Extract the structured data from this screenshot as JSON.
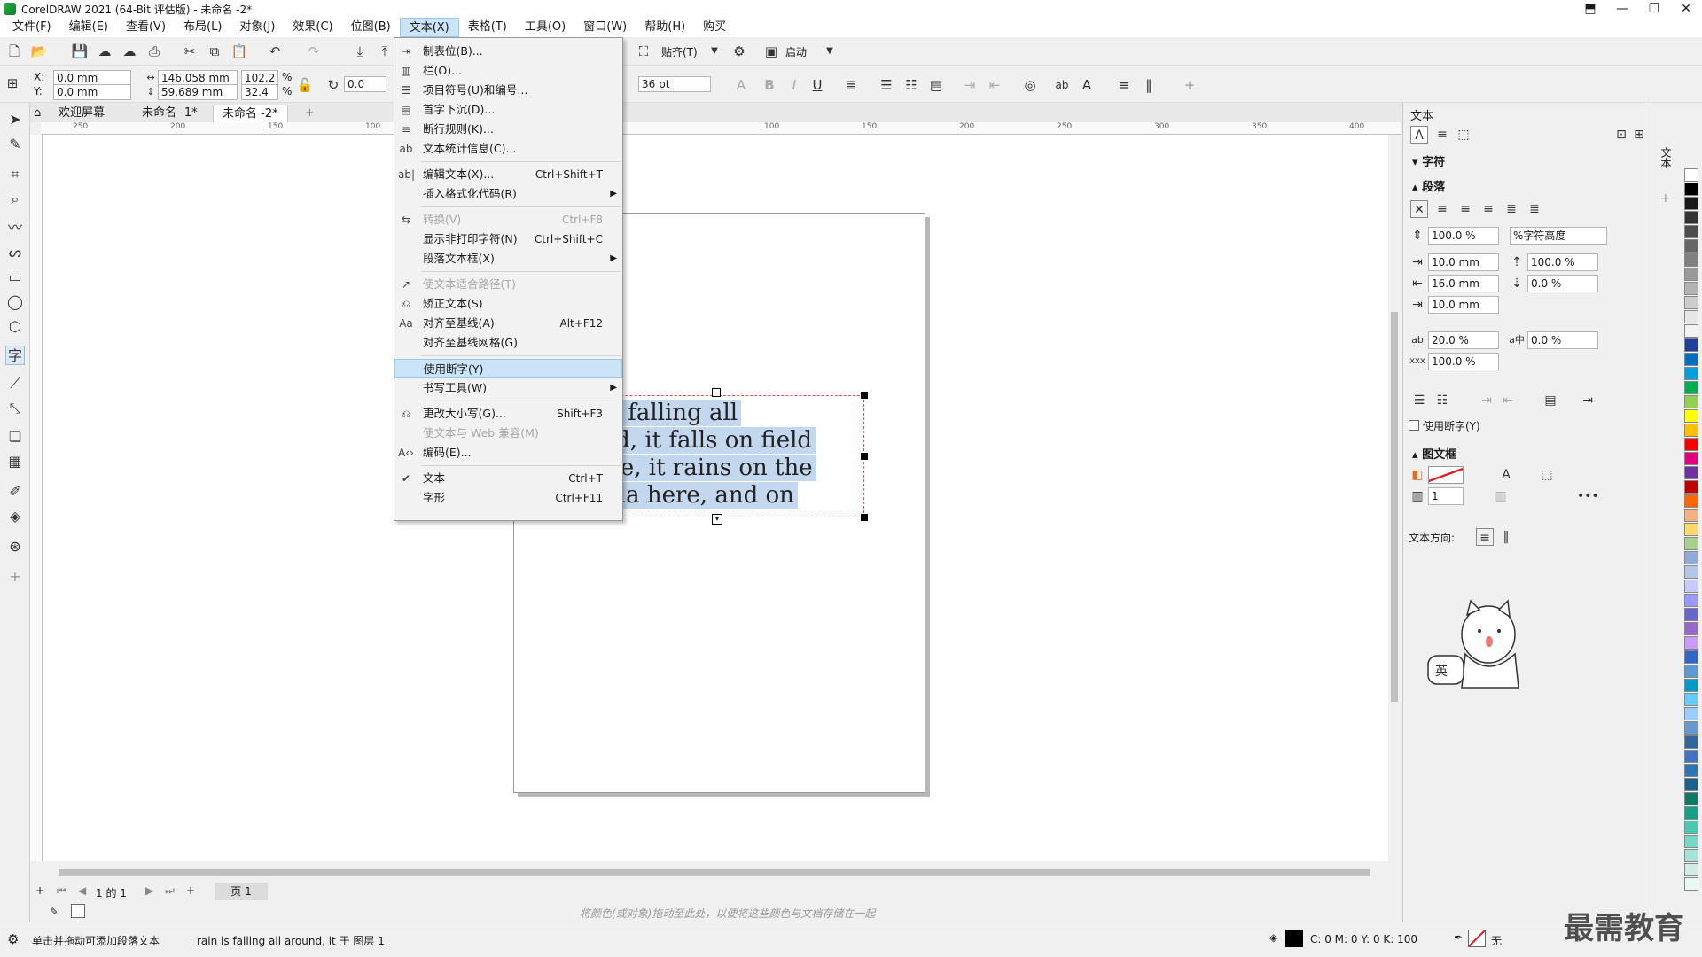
{
  "window": {
    "title": "CorelDRAW 2021 (64-Bit 评估版) - 未命名 -2*",
    "controls": [
      "⬒",
      "—",
      "❐",
      "✕"
    ]
  },
  "menubar": [
    "文件(F)",
    "编辑(E)",
    "查看(V)",
    "布局(L)",
    "对象(J)",
    "效果(C)",
    "位图(B)",
    "文本(X)",
    "表格(T)",
    "工具(O)",
    "窗口(W)",
    "帮助(H)",
    "购买"
  ],
  "toolbar1": {
    "snap_label": "贴齐(T)",
    "launch_label": "启动"
  },
  "toolbar2": {
    "x": "0.0 mm",
    "y": "0.0 mm",
    "width": "146.058 mm",
    "height": "59.689 mm",
    "scale_w": "102.2",
    "scale_h": "32.4",
    "pct": "%",
    "rotation": "0.0",
    "font_size": "36 pt",
    "x_label": "X:",
    "y_label": "Y:"
  },
  "tabs": {
    "home": "欢迎屏幕",
    "doc1": "未命名 -1*",
    "doc2": "未命名 -2*"
  },
  "ruler_labels": [
    "250",
    "200",
    "150",
    "100",
    "100",
    "150",
    "200",
    "250",
    "300",
    "350",
    "400"
  ],
  "text_frame": {
    "lines": [
      "in is falling all",
      "ound, it falls on field",
      "l tree, it rains on the",
      "brella here, and on"
    ]
  },
  "text_menu": [
    {
      "icon": "tabs-icon",
      "glyph": "⇥",
      "label": "制表位(B)...",
      "shortcut": "",
      "disabled": false,
      "submenu": false
    },
    {
      "icon": "columns-icon",
      "glyph": "▥",
      "label": "栏(O)...",
      "shortcut": "",
      "disabled": false,
      "submenu": false
    },
    {
      "icon": "bullets-icon",
      "glyph": "☰",
      "label": "项目符号(U)和编号...",
      "shortcut": "",
      "disabled": false,
      "submenu": false
    },
    {
      "icon": "dropcap-icon",
      "glyph": "▤",
      "label": "首字下沉(D)...",
      "shortcut": "",
      "disabled": false,
      "submenu": false
    },
    {
      "icon": "linebreak-icon",
      "glyph": "≡",
      "label": "断行规则(K)...",
      "shortcut": "",
      "disabled": false,
      "submenu": false
    },
    {
      "icon": "stats-icon",
      "glyph": "ab",
      "label": "文本统计信息(C)...",
      "shortcut": "",
      "disabled": false,
      "submenu": false
    },
    {
      "icon": "edit-text-icon",
      "glyph": "ab|",
      "label": "编辑文本(X)...",
      "shortcut": "Ctrl+Shift+T",
      "disabled": false,
      "submenu": false
    },
    {
      "icon": "",
      "glyph": "",
      "label": "插入格式化代码(R)",
      "shortcut": "",
      "disabled": false,
      "submenu": true
    },
    {
      "icon": "convert-icon",
      "glyph": "⇆",
      "label": "转换(V)",
      "shortcut": "Ctrl+F8",
      "disabled": true,
      "submenu": false
    },
    {
      "icon": "",
      "glyph": "",
      "label": "显示非打印字符(N)",
      "shortcut": "Ctrl+Shift+C",
      "disabled": false,
      "submenu": false
    },
    {
      "icon": "",
      "glyph": "",
      "label": "段落文本框(X)",
      "shortcut": "",
      "disabled": false,
      "submenu": true
    },
    {
      "icon": "fit-path-icon",
      "glyph": "↗",
      "label": "使文本适合路径(T)",
      "shortcut": "",
      "disabled": true,
      "submenu": false
    },
    {
      "icon": "straighten-icon",
      "glyph": "⎌",
      "label": "矫正文本(S)",
      "shortcut": "",
      "disabled": false,
      "submenu": false
    },
    {
      "icon": "baseline-icon",
      "glyph": "Aa",
      "label": "对齐至基线(A)",
      "shortcut": "Alt+F12",
      "disabled": false,
      "submenu": false
    },
    {
      "icon": "",
      "glyph": "",
      "label": "对齐至基线网格(G)",
      "shortcut": "",
      "disabled": false,
      "submenu": false
    },
    {
      "icon": "",
      "glyph": "",
      "label": "使用断字(Y)",
      "shortcut": "",
      "disabled": false,
      "submenu": false,
      "highlight": true
    },
    {
      "icon": "",
      "glyph": "",
      "label": "书写工具(W)",
      "shortcut": "",
      "disabled": false,
      "submenu": true
    },
    {
      "icon": "change-case-icon",
      "glyph": "⎌",
      "label": "更改大小写(G)...",
      "shortcut": "Shift+F3",
      "disabled": false,
      "submenu": false
    },
    {
      "icon": "",
      "glyph": "",
      "label": "使文本与 Web 兼容(M)",
      "shortcut": "",
      "disabled": true,
      "submenu": false
    },
    {
      "icon": "encoding-icon",
      "glyph": "A‹›",
      "label": "编码(E)...",
      "shortcut": "",
      "disabled": false,
      "submenu": false
    },
    {
      "icon": "check-icon",
      "glyph": "✔",
      "label": "文本",
      "shortcut": "Ctrl+T",
      "disabled": false,
      "submenu": false
    },
    {
      "icon": "",
      "glyph": "",
      "label": "字形",
      "shortcut": "Ctrl+F11",
      "disabled": false,
      "submenu": false
    }
  ],
  "docker": {
    "title": "文本",
    "section_char": "字符",
    "section_para": "段落",
    "para": {
      "line_spacing": "100.0 %",
      "line_spacing_unit": "%字符高度",
      "indent_first": "10.0 mm",
      "indent_left": "16.0 mm",
      "indent_right": "10.0 mm",
      "space_before": "100.0 %",
      "space_after": "0.0 %",
      "char_spacing": "20.0 %",
      "lang_spacing": "0.0 %",
      "word_spacing": "100.0 %",
      "hyphen_label": "使用断字(Y)"
    },
    "section_frame": "图文框",
    "frame": {
      "columns": "1",
      "direction_label": "文本方向:"
    }
  },
  "pagenav": {
    "page_of": "1 的 1",
    "page_tab": "页 1"
  },
  "palette_hint": "将颜色(或对象)拖动至此处，以便将这些颜色与文档存储在一起",
  "status": {
    "hint": "单击并拖动可添加段落文本",
    "object_info": "rain is falling all around, it 于 图层 1",
    "cmyk": "C: 0 M: 0 Y: 0 K: 100",
    "outline": "无"
  },
  "watermark": "最需教育",
  "mascot_label": "英",
  "palette_colors": [
    "#ffffff",
    "#000000",
    "#1a1a1a",
    "#333333",
    "#4d4d4d",
    "#666666",
    "#808080",
    "#999999",
    "#b3b3b3",
    "#cccccc",
    "#e6e6e6",
    "#f2f2f2",
    "#1f3f9f",
    "#0070c0",
    "#00a0e0",
    "#00b050",
    "#92d050",
    "#ffff00",
    "#ffc000",
    "#ff0000",
    "#e6007e",
    "#7030a0",
    "#c00000",
    "#ff6600",
    "#f4b183",
    "#ffd966",
    "#a9d18e",
    "#8faadc",
    "#b4c7e7",
    "#c9c9ff",
    "#9999ff",
    "#6666cc",
    "#9966cc",
    "#cc99ff",
    "#3366cc",
    "#5b9bd5",
    "#0099cc",
    "#66ccff",
    "#99ccff",
    "#6699cc",
    "#336699",
    "#4472c4",
    "#2e75b6",
    "#1f618d",
    "#117a65",
    "#16a085",
    "#48c9b0",
    "#76d7c4",
    "#a3e4d7",
    "#d0ece7",
    "#e8f8f5"
  ]
}
